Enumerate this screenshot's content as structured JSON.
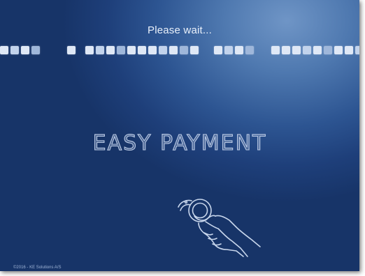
{
  "screen": {
    "status_text": "Please wait...",
    "brand_text": "EASY PAYMENT",
    "copyright": "©2016 - KE Solutions A/S",
    "progress_icon": "segmented-progress-bar",
    "tap_icon": "hand-holding-key-tag-icon",
    "colors": {
      "background_dark": "#173468",
      "background_light": "#6f95c6",
      "text": "#e9f0fa",
      "segment": "#dfe8f6"
    }
  }
}
